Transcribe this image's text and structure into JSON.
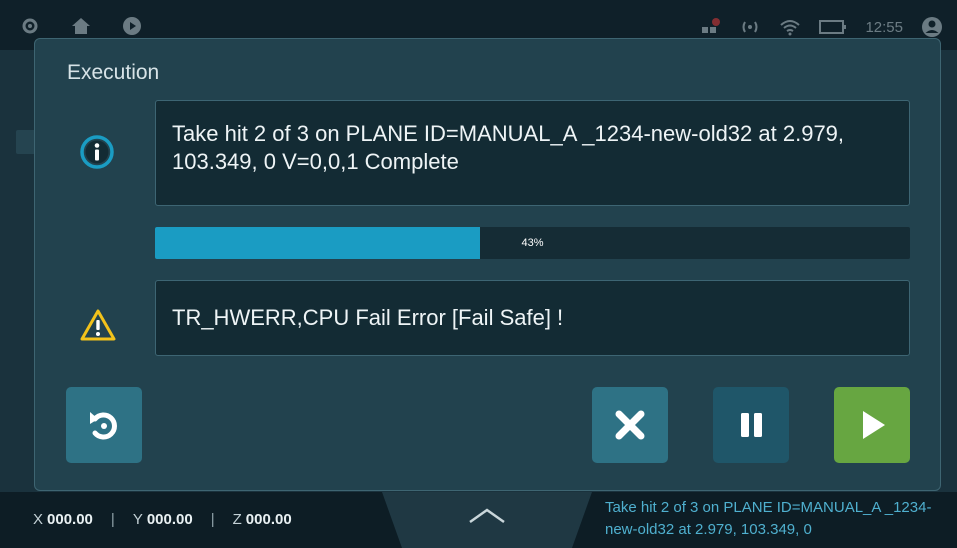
{
  "top_bar": {
    "clock": "12:55",
    "icons": [
      "gear-icon",
      "home-icon",
      "play-circle-icon",
      "network-alert-icon",
      "radio-signal-icon",
      "wifi-icon",
      "battery-icon",
      "user-icon"
    ]
  },
  "dialog": {
    "title": "Execution",
    "info_message": "Take hit 2 of 3 on PLANE ID=MANUAL_A _1234-new-old32 at 2.979, 103.349, 0  V=0,0,1 Complete",
    "progress": {
      "percent": 43,
      "label": "43%"
    },
    "error_message": "TR_HWERR,CPU Fail Error [Fail Safe] !",
    "buttons": {
      "restart": "restart-icon",
      "cancel": "close-icon",
      "pause": "pause-icon",
      "run": "play-icon"
    }
  },
  "bottom_bar": {
    "x_label": "X",
    "x_value": "000.00",
    "y_label": "Y",
    "y_value": "000.00",
    "z_label": "Z",
    "z_value": "000.00",
    "separator": "|",
    "status_message": "Take  hit 2 of 3 on PLANE ID=MANUAL_A _1234-new-old32 at 2.979, 103.349, 0"
  },
  "colors": {
    "accent": "#1a9cc3",
    "warning": "#f2c21b",
    "run_green": "#67a641",
    "dialog_bg": "#22424e"
  }
}
